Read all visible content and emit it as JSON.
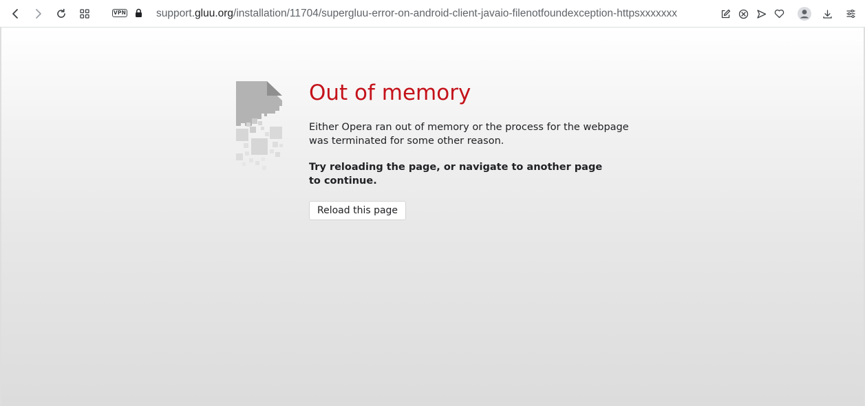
{
  "browser": {
    "url": {
      "host_prefix": "support.",
      "host": "gluu.org",
      "path": "/installation/11704/supergluu-error-on-android-client-javaio-filenotfoundexception-httpsxxxxxxx"
    },
    "vpn_label": "VPN",
    "icons": {
      "back": "back-arrow-icon",
      "forward": "forward-arrow-icon",
      "reload": "reload-icon",
      "tabs": "speed-dial-grid-icon",
      "vpn": "vpn-badge-icon",
      "lock": "lock-icon",
      "snapshot": "snapshot-edit-icon",
      "adblock": "adblock-shield-icon",
      "send": "send-to-flow-icon",
      "bookmark": "heart-icon",
      "profile": "profile-avatar-icon",
      "downloads": "download-icon",
      "easy_setup": "easy-setup-icon"
    }
  },
  "error_page": {
    "title": "Out of memory",
    "description": "Either Opera ran out of memory or the process for the webpage was terminated for some other reason.",
    "hint": "Try reloading the page, or navigate to another page to continue.",
    "reload_button": "Reload this page",
    "title_color": "#c4121a"
  }
}
